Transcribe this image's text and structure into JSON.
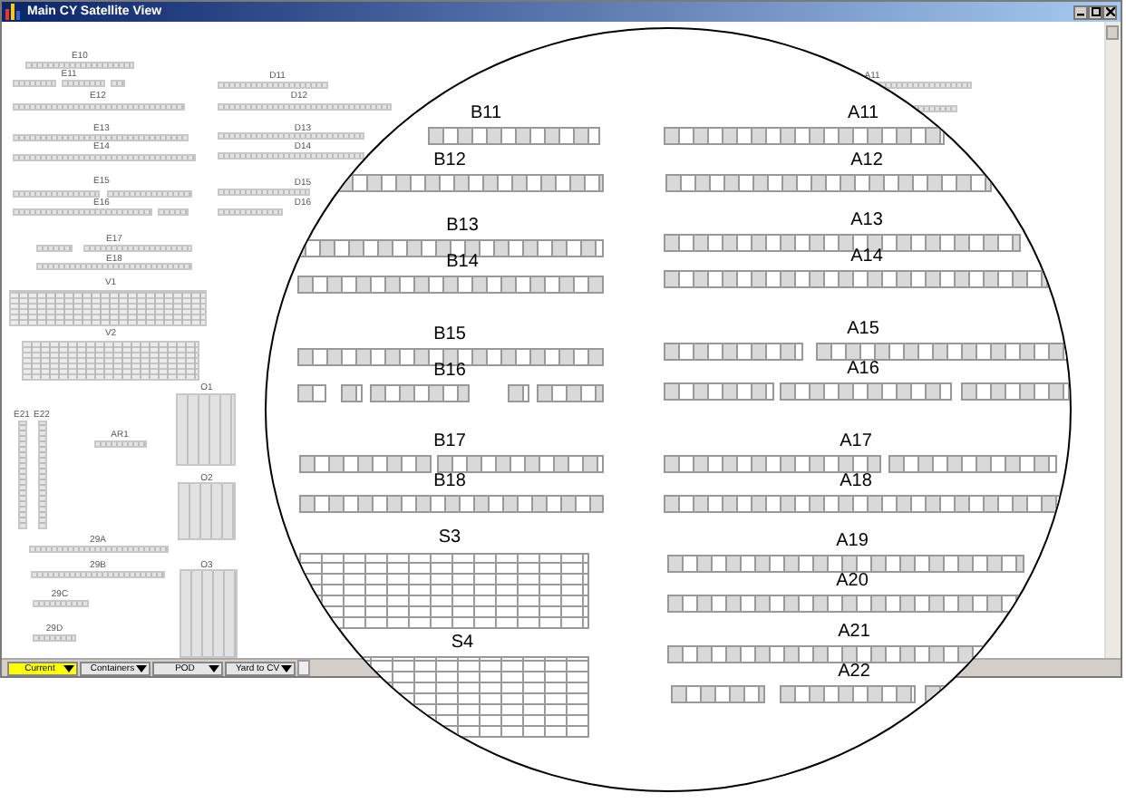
{
  "window": {
    "title": "Main CY Satellite View"
  },
  "overview_blocks": [
    {
      "label": "E10"
    },
    {
      "label": "E11"
    },
    {
      "label": "E12"
    },
    {
      "label": "E13"
    },
    {
      "label": "E14"
    },
    {
      "label": "E15"
    },
    {
      "label": "E16"
    },
    {
      "label": "E17"
    },
    {
      "label": "E18"
    },
    {
      "label": "V1"
    },
    {
      "label": "V2"
    },
    {
      "label": "D11"
    },
    {
      "label": "A11"
    },
    {
      "label": "D12"
    },
    {
      "label": "D13"
    },
    {
      "label": "D14"
    },
    {
      "label": "D15"
    },
    {
      "label": "D16"
    },
    {
      "label": "O1"
    },
    {
      "label": "E21"
    },
    {
      "label": "E22"
    },
    {
      "label": "AR1"
    },
    {
      "label": "O2"
    },
    {
      "label": "29A"
    },
    {
      "label": "29B"
    },
    {
      "label": "O3"
    },
    {
      "label": "29C"
    },
    {
      "label": "29D"
    }
  ],
  "lens_blocks": [
    {
      "label": "B11"
    },
    {
      "label": "B12"
    },
    {
      "label": "B13"
    },
    {
      "label": "B14"
    },
    {
      "label": "B15"
    },
    {
      "label": "B16"
    },
    {
      "label": "B17"
    },
    {
      "label": "B18"
    },
    {
      "label": "S3"
    },
    {
      "label": "S4"
    },
    {
      "label": "A11"
    },
    {
      "label": "A12"
    },
    {
      "label": "A13"
    },
    {
      "label": "A14"
    },
    {
      "label": "A15"
    },
    {
      "label": "A16"
    },
    {
      "label": "A17"
    },
    {
      "label": "A18"
    },
    {
      "label": "A19"
    },
    {
      "label": "A20"
    },
    {
      "label": "A21"
    },
    {
      "label": "A22"
    }
  ],
  "toolbar": [
    {
      "label": "Current",
      "selected": true
    },
    {
      "label": "Containers",
      "selected": false
    },
    {
      "label": "POD",
      "selected": false
    },
    {
      "label": "Yard to CV",
      "selected": false
    }
  ]
}
